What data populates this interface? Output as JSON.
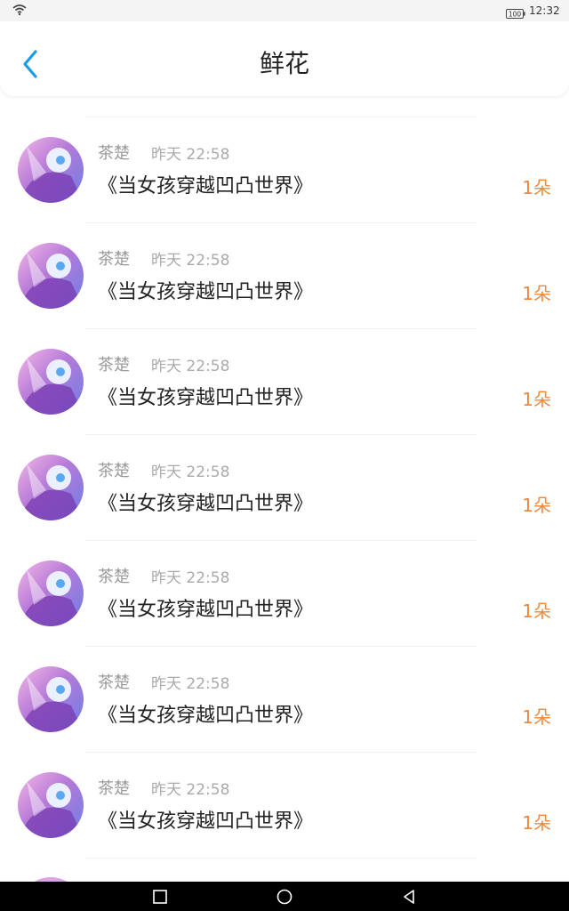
{
  "status_bar": {
    "time": "12:32",
    "battery": "100",
    "wifi_icon": "wifi-icon",
    "battery_icon": "battery-icon"
  },
  "header": {
    "title": "鲜花",
    "back_icon": "chevron-left-icon"
  },
  "flower_list": [
    {
      "user": "茶楚",
      "time": "昨天 22:58",
      "book": "《当女孩穿越凹凸世界》",
      "count": "1朵"
    },
    {
      "user": "茶楚",
      "time": "昨天 22:58",
      "book": "《当女孩穿越凹凸世界》",
      "count": "1朵"
    },
    {
      "user": "茶楚",
      "time": "昨天 22:58",
      "book": "《当女孩穿越凹凸世界》",
      "count": "1朵"
    },
    {
      "user": "茶楚",
      "time": "昨天 22:58",
      "book": "《当女孩穿越凹凸世界》",
      "count": "1朵"
    },
    {
      "user": "茶楚",
      "time": "昨天 22:58",
      "book": "《当女孩穿越凹凸世界》",
      "count": "1朵"
    },
    {
      "user": "茶楚",
      "time": "昨天 22:58",
      "book": "《当女孩穿越凹凸世界》",
      "count": "1朵"
    },
    {
      "user": "茶楚",
      "time": "昨天 22:58",
      "book": "《当女孩穿越凹凸世界》",
      "count": "1朵"
    }
  ],
  "colors": {
    "accent_orange": "#f0883a",
    "back_blue": "#1a9be6",
    "username_gray": "#999999"
  },
  "nav_bar": {
    "recents_icon": "square-icon",
    "home_icon": "circle-icon",
    "back_icon": "triangle-back-icon"
  }
}
